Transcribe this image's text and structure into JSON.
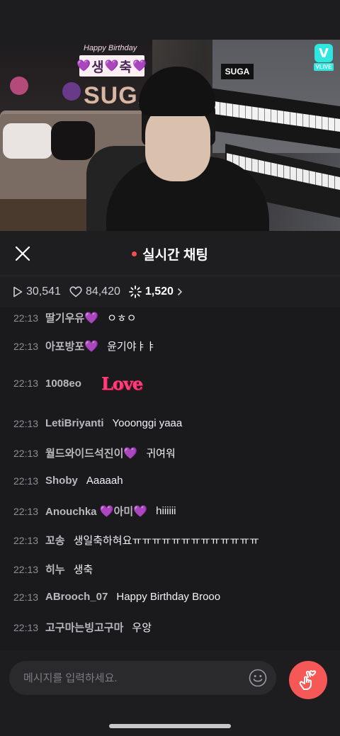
{
  "video": {
    "banner_top": "Happy Birthday",
    "banner_text": "💜생💜축💜",
    "balloon_text": "SUGA",
    "sign_text": "SUGA",
    "vlive_logo_label": "VLIVE"
  },
  "header": {
    "title": "실시간 채팅"
  },
  "stats": {
    "plays": "30,541",
    "likes": "84,420",
    "comments": "1,520"
  },
  "messages": [
    {
      "time": "22:13",
      "user": "딸기우유💜",
      "text": "ㅇㅎㅇ"
    },
    {
      "time": "22:13",
      "user": "아포방포💜",
      "text": "윤기야ㅑㅑ"
    },
    {
      "time": "22:13",
      "user": "1008eo",
      "text": "",
      "sticker": "Love"
    },
    {
      "time": "22:13",
      "user": "LetiBriyanti",
      "text": "Yooonggi yaaa"
    },
    {
      "time": "22:13",
      "user": "월드와이드석진이💜",
      "text": "귀여워"
    },
    {
      "time": "22:13",
      "user": "Shoby",
      "text": "Aaaaah"
    },
    {
      "time": "22:13",
      "user": "Anouchka 💜아미💜",
      "text": "hiiiiii"
    },
    {
      "time": "22:13",
      "user": "꼬송",
      "text": "생일축하혀요ㅠㅠㅠㅠㅠㅠㅠㅠㅠㅠㅠㅠㅠ"
    },
    {
      "time": "22:13",
      "user": "히누",
      "text": "생축"
    },
    {
      "time": "22:13",
      "user": "ABrooch_07",
      "text": "Happy Birthday Brooo"
    },
    {
      "time": "22:13",
      "user": "고구마는빙고구마",
      "text": "우앙"
    }
  ],
  "input": {
    "placeholder": "메시지를 입력하세요."
  },
  "colors": {
    "accent": "#f65858",
    "live_dot": "#ff4c4c",
    "heart_emoji": "#a259e8",
    "vlive": "#2ee8e0"
  }
}
